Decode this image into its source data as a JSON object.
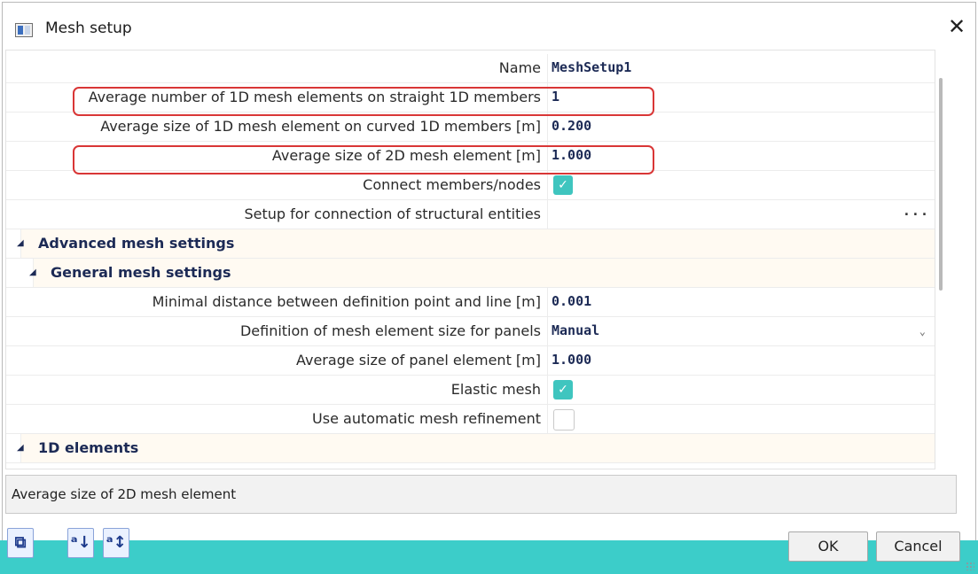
{
  "window": {
    "title": "Mesh setup",
    "close_label": "✕"
  },
  "properties": [
    {
      "type": "text",
      "label": "Name",
      "value": "MeshSetup1"
    },
    {
      "type": "text",
      "label": "Average number of 1D mesh elements on straight 1D members",
      "value": "1"
    },
    {
      "type": "text",
      "label": "Average size of 1D mesh element on curved 1D members [m]",
      "value": "0.200"
    },
    {
      "type": "text",
      "label": "Average size of 2D mesh element [m]",
      "value": "1.000"
    },
    {
      "type": "checkbox",
      "label": "Connect members/nodes",
      "checked": true
    },
    {
      "type": "button",
      "label": "Setup for connection of structural entities",
      "value": "···"
    },
    {
      "type": "section",
      "label": "Advanced mesh settings",
      "toggle": "◢"
    },
    {
      "type": "section",
      "label": "General mesh settings",
      "toggle": "◢"
    },
    {
      "type": "text",
      "label": "Minimal distance between definition point and line [m]",
      "value": "0.001"
    },
    {
      "type": "select",
      "label": "Definition of mesh element size for panels",
      "value": "Manual",
      "arrow": "⌄"
    },
    {
      "type": "text",
      "label": "Average size of panel element [m]",
      "value": "1.000"
    },
    {
      "type": "checkbox",
      "label": "Elastic mesh",
      "checked": true
    },
    {
      "type": "checkbox",
      "label": "Use automatic mesh refinement",
      "checked": false
    },
    {
      "type": "section",
      "label": "1D elements",
      "toggle": "◢"
    }
  ],
  "checkmark": "✓",
  "description": "Average size of 2D mesh element",
  "toolbar": {
    "tools": [
      {
        "name": "import-setup-button",
        "glyph": "⧉"
      },
      {
        "name": "sort-ascending-button",
        "glyph": "ᵃ↓"
      },
      {
        "name": "sort-custom-button",
        "glyph": "ᵃ↕"
      }
    ]
  },
  "buttons": {
    "ok": "OK",
    "cancel": "Cancel"
  },
  "colors": {
    "accent": "#3ccdc9",
    "highlight": "#d93636",
    "label_text": "#2a2a2a",
    "value_text": "#1c2a55"
  }
}
